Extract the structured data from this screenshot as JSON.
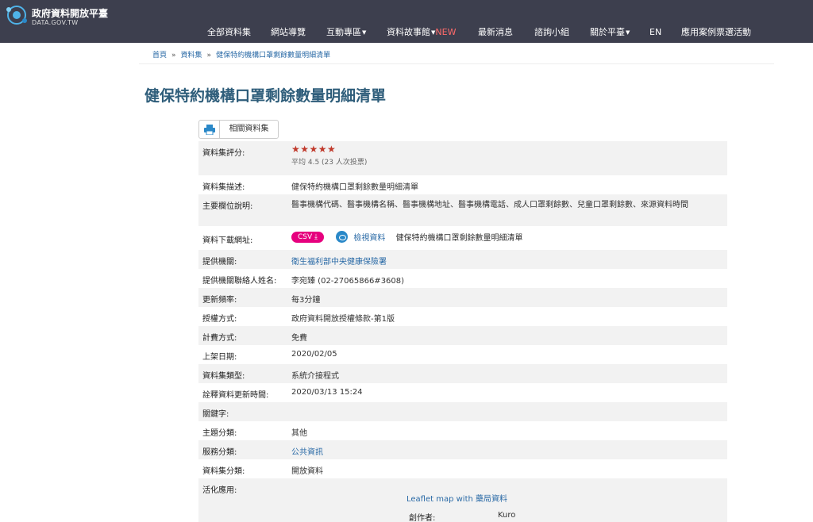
{
  "header": {
    "logo_title": "政府資料開放平臺",
    "logo_sub": "DATA.GOV.TW",
    "nav": [
      {
        "label": "全部資料集"
      },
      {
        "label": "網站導覽"
      },
      {
        "label": "互動專區"
      },
      {
        "label": "資料故事館"
      },
      {
        "label": "最新消息"
      },
      {
        "label": "諮詢小組"
      },
      {
        "label": "關於平臺"
      },
      {
        "label": "EN"
      },
      {
        "label": "應用案例票選活動"
      }
    ],
    "nav_new": "NEW"
  },
  "breadcrumb": {
    "home": "首頁",
    "datasets": "資料集",
    "current": "健保特約機構口罩剩餘數量明細清單",
    "separator": "»"
  },
  "page_title": "健保特約機構口罩剩餘數量明細清單",
  "buttons": {
    "related": "相關資料集"
  },
  "details": {
    "rating_label": "資料集評分:",
    "rating_stars": "★★★★★",
    "rating_value": 4.5,
    "rating_text": "平均 4.5 (23 人次投票)",
    "desc_label": "資料集描述:",
    "desc_value": "健保特約機構口罩剩餘數量明細清單",
    "fields_label": "主要欄位說明:",
    "fields_value": "醫事機構代碼、醫事機構名稱、醫事機構地址、醫事機構電話、成人口罩剩餘數、兒童口罩剩餘數、來源資料時間",
    "download_label": "資料下載網址:",
    "download_format": "CSV",
    "download_preview": "檢視資料",
    "download_name": "健保特約機構口罩剩餘數量明細清單",
    "provider_label": "提供機關:",
    "provider_value": "衛生福利部中央健康保險署",
    "contact_label": "提供機關聯絡人姓名:",
    "contact_value": "李宛臻 (02-27065866#3608)",
    "freq_label": "更新頻率:",
    "freq_value": "每3分鐘",
    "license_label": "授權方式:",
    "license_value": "政府資料開放授權條款-第1版",
    "fee_label": "計費方式:",
    "fee_value": "免費",
    "date_label": "上架日期:",
    "date_value": "2020/02/05",
    "type_label": "資料集類型:",
    "type_value": "系統介接程式",
    "meta_label": "詮釋資料更新時間:",
    "meta_value": "2020/03/13 15:24",
    "keyword_label": "關鍵字:",
    "keyword_value": "",
    "topic_label": "主題分類:",
    "topic_value": "其他",
    "service_label": "服務分類:",
    "service_value": "公共資訊",
    "class_label": "資料集分類:",
    "class_value": "開放資料",
    "apps_label": "活化應用:",
    "app_title": "Leaflet map with 藥局資料",
    "app_author_label": "創作者:",
    "app_author_value": "Kuro"
  }
}
